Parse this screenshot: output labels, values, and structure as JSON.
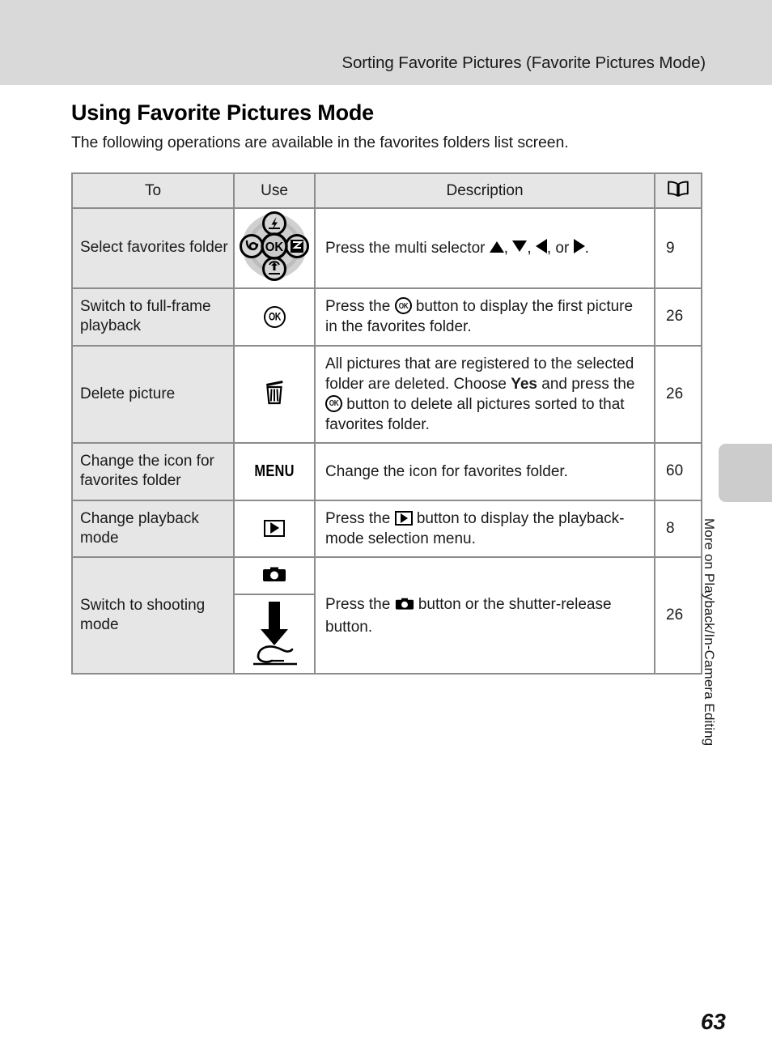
{
  "header": {
    "running_title": "Sorting Favorite Pictures (Favorite Pictures Mode)"
  },
  "section": {
    "title": "Using Favorite Pictures Mode",
    "intro": "The following operations are available in the favorites folders list screen."
  },
  "table": {
    "columns": {
      "to": "To",
      "use": "Use",
      "description": "Description",
      "reference_icon": "open-book-icon"
    },
    "rows": [
      {
        "to": "Select favorites folder",
        "use_icon": "multi-selector-icon",
        "description_parts": [
          {
            "type": "text",
            "value": "Press the multi selector "
          },
          {
            "type": "icon",
            "value": "triangle-up-icon"
          },
          {
            "type": "text",
            "value": ", "
          },
          {
            "type": "icon",
            "value": "triangle-down-icon"
          },
          {
            "type": "text",
            "value": ", "
          },
          {
            "type": "icon",
            "value": "triangle-left-icon"
          },
          {
            "type": "text",
            "value": ", or "
          },
          {
            "type": "icon",
            "value": "triangle-right-icon"
          },
          {
            "type": "text",
            "value": "."
          }
        ],
        "description_text": "Press the multi selector ▲, ▼, ◀, or ▶.",
        "reference": "9"
      },
      {
        "to": "Switch to full-frame playback",
        "use_icon": "ok-button-icon",
        "description_text": "Press the OK button to display the first picture in the favorites folder.",
        "description_lead": "Press the ",
        "description_tail": " button to display the first picture in the favorites folder.",
        "reference": "26"
      },
      {
        "to": "Delete picture",
        "use_icon": "trash-icon",
        "description_text": "All pictures that are registered to the selected folder are deleted. Choose Yes and press the OK button to delete all pictures sorted to that favorites folder.",
        "description_seg1": "All pictures that are registered to the selected folder are deleted. Choose ",
        "description_bold": "Yes",
        "description_seg2": " and press the ",
        "description_seg3": " button to delete all pictures sorted to that favorites folder.",
        "reference": "26"
      },
      {
        "to": "Change the icon for favorites folder",
        "use_icon": "menu-button-icon",
        "use_label": "MENU",
        "description_text": "Change the icon for favorites folder.",
        "reference": "60"
      },
      {
        "to": "Change playback mode",
        "use_icon": "playback-button-icon",
        "description_text": "Press the playback button to display the playback-mode selection menu.",
        "description_lead": "Press the ",
        "description_tail": " button to display the playback-mode selection menu.",
        "reference": "8"
      },
      {
        "to": "Switch to shooting mode",
        "use_icon_top": "camera-shooting-mode-icon",
        "use_icon_bottom": "shutter-release-press-icon",
        "description_text": "Press the camera button or the shutter-release button.",
        "description_lead": "Press the ",
        "description_tail": " button or the shutter-release button.",
        "reference": "26"
      }
    ]
  },
  "side_tab": {
    "label": "More on Playback/In-Camera Editing"
  },
  "footer": {
    "page_number": "63"
  },
  "colors": {
    "header_band": "#d9d9d9",
    "table_border": "#8c8c8c",
    "cell_shade": "#e6e6e6",
    "side_tab": "#cccccc"
  }
}
